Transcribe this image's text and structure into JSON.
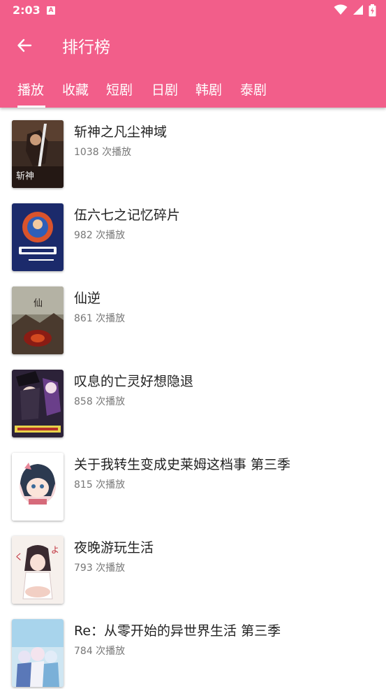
{
  "status_bar": {
    "time": "2:03",
    "notification_badge": "A"
  },
  "header": {
    "title": "排行榜"
  },
  "tabs": [
    {
      "label": "播放",
      "selected": true
    },
    {
      "label": "收藏",
      "selected": false
    },
    {
      "label": "短剧",
      "selected": false
    },
    {
      "label": "日剧",
      "selected": false
    },
    {
      "label": "韩剧",
      "selected": false
    },
    {
      "label": "泰剧",
      "selected": false
    }
  ],
  "count_suffix": "次播放",
  "rankings": [
    {
      "name": "斩神之凡尘神域",
      "plays": "1038 次播放"
    },
    {
      "name": "伍六七之记忆碎片",
      "plays": "982 次播放"
    },
    {
      "name": "仙逆",
      "plays": "861 次播放"
    },
    {
      "name": "叹息的亡灵好想隐退",
      "plays": "858 次播放"
    },
    {
      "name": "关于我转生变成史莱姆这档事 第三季",
      "plays": "815 次播放"
    },
    {
      "name": "夜晚游玩生活",
      "plays": "793 次播放"
    },
    {
      "name": "Re：从零开始的异世界生活 第三季",
      "plays": "784 次播放"
    }
  ],
  "colors": {
    "accent": "#F25E8A",
    "text": "#222222",
    "subtext": "#777777"
  }
}
